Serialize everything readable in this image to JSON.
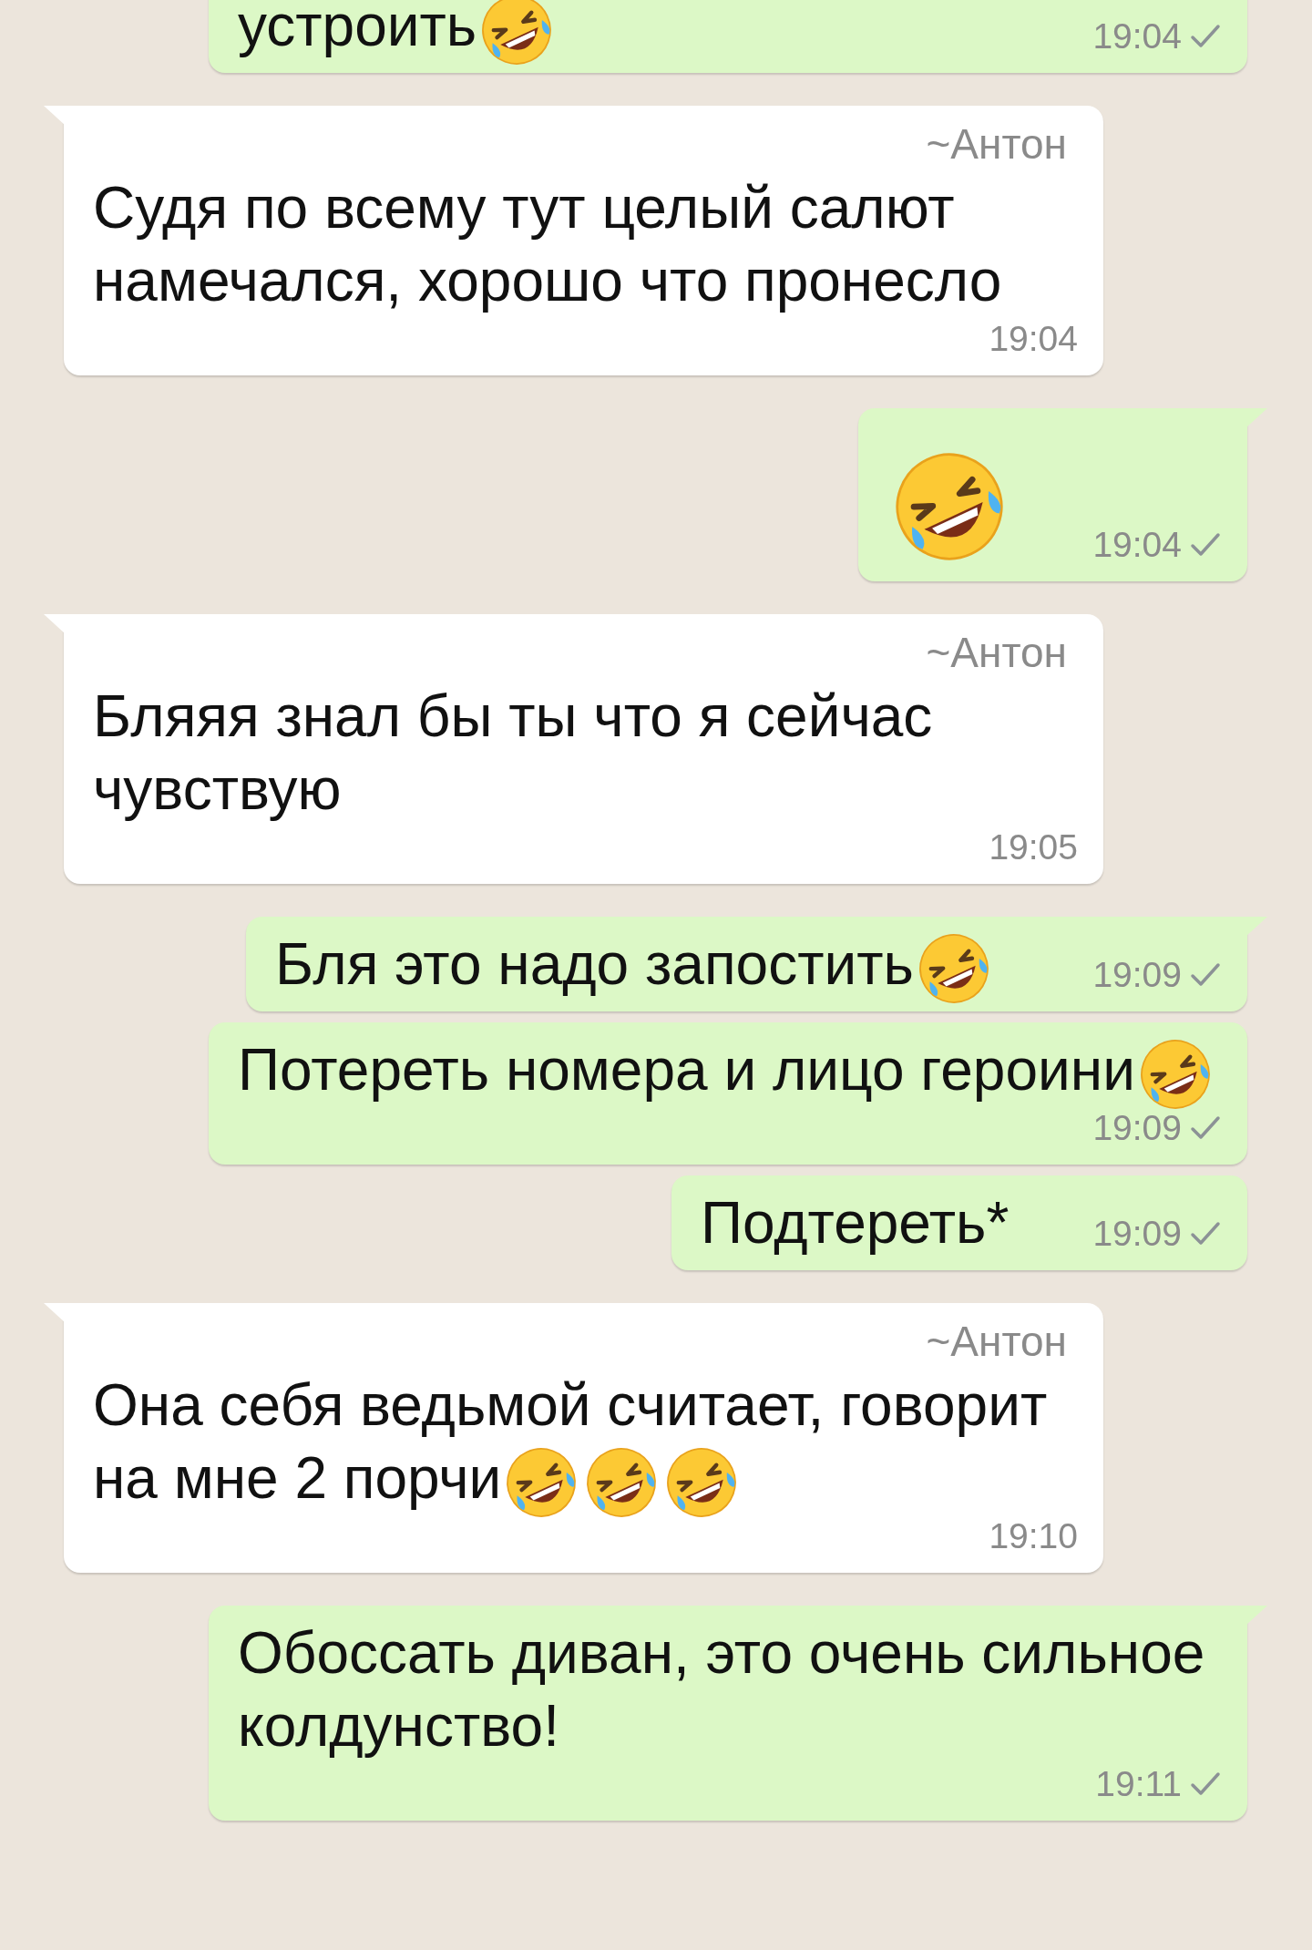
{
  "messages": [
    {
      "kind": "outgoing",
      "parts": [
        {
          "kind": "text",
          "text": "устроить"
        },
        {
          "kind": "emoji"
        }
      ],
      "time": "19:04",
      "read": false
    },
    {
      "kind": "incoming",
      "sender": "~Антон",
      "parts": [
        {
          "kind": "text",
          "text": "Судя по всему тут целый салют намечался, хорошо что пронесло"
        }
      ],
      "time": "19:04"
    },
    {
      "kind": "outgoing",
      "parts": [
        {
          "kind": "emoji"
        }
      ],
      "time": "19:04",
      "read": false
    },
    {
      "kind": "incoming",
      "sender": "~Антон",
      "parts": [
        {
          "kind": "text",
          "text": "Бляяя знал бы ты что я сейчас чувствую"
        }
      ],
      "time": "19:05"
    },
    {
      "kind": "outgoing",
      "parts": [
        {
          "kind": "text",
          "text": "Бля это надо запостить"
        },
        {
          "kind": "emoji"
        }
      ],
      "time": "19:09",
      "read": false
    },
    {
      "kind": "outgoing",
      "parts": [
        {
          "kind": "text",
          "text": "Потереть номера и лицо героини"
        },
        {
          "kind": "emoji"
        }
      ],
      "time": "19:09",
      "read": false
    },
    {
      "kind": "outgoing",
      "parts": [
        {
          "kind": "text",
          "text": "Подтереть*"
        }
      ],
      "time": "19:09",
      "read": false
    },
    {
      "kind": "incoming",
      "sender": "~Антон",
      "parts": [
        {
          "kind": "text",
          "text": "Она себя ведьмой считает, говорит"
        },
        {
          "kind": "text",
          "text": "на мне 2 порчи"
        },
        {
          "kind": "emoji"
        },
        {
          "kind": "emoji"
        },
        {
          "kind": "emoji"
        }
      ],
      "time": "19:10"
    },
    {
      "kind": "outgoing",
      "parts": [
        {
          "kind": "text",
          "text": "Обоссать диван, это очень сильное колдунство!"
        }
      ],
      "time": "19:11",
      "read": false
    }
  ]
}
